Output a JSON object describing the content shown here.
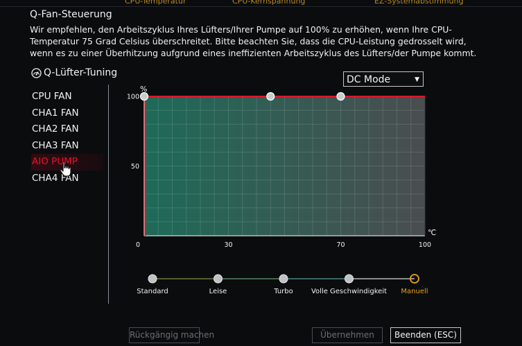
{
  "header": {
    "ghost_tabs": [
      "CPU-Temperatur",
      "CPU-Kernspannung",
      "EZ-Systemabstimmung"
    ],
    "title": "Q-Fan-Steuerung",
    "description": "Wir empfehlen, den Arbeitszyklus Ihres Lüfters/Ihrer Pumpe auf 100% zu erhöhen, wenn Ihre CPU-Temperatur 75 Grad Celsius überschreitet. Bitte beachten Sie, dass die CPU-Leistung gedrosselt wird, wenn es zu einer Überhitzung aufgrund eines ineffizienten Arbeitszyklus des Lüfters/der Pumpe kommt."
  },
  "tuning": {
    "title": "Q-Lüfter-Tuning",
    "icon": "fan-gauge-icon",
    "fans": [
      "CPU FAN",
      "CHA1 FAN",
      "CHA2 FAN",
      "CHA3 FAN",
      "AIO PUMP",
      "CHA4 FAN"
    ],
    "active_fan": "AIO PUMP"
  },
  "mode_select": {
    "value": "DC Mode"
  },
  "chart_data": {
    "type": "line",
    "ylabel": "%",
    "xlabel": "℃",
    "x_ticks": [
      "0",
      "30",
      "70",
      "100"
    ],
    "y_ticks": [
      "100",
      "50"
    ],
    "xlim": [
      0,
      100
    ],
    "ylim": [
      0,
      100
    ],
    "points": [
      {
        "x": 0,
        "y": 100
      },
      {
        "x": 45,
        "y": 100
      },
      {
        "x": 70,
        "y": 100
      }
    ],
    "colors": {
      "curve": "#e0162b",
      "fill_start": "#1e6a58",
      "fill_end": "#4a4d4f"
    }
  },
  "presets": {
    "items": [
      "Standard",
      "Leise",
      "Turbo",
      "Volle Geschwindigkeit",
      "Manuell"
    ],
    "selected": "Manuell",
    "colors": {
      "selected": "#e6a11e"
    }
  },
  "buttons": {
    "undo": "Rückgängig machen",
    "apply": "Übernehmen",
    "exit": "Beenden (ESC)"
  }
}
